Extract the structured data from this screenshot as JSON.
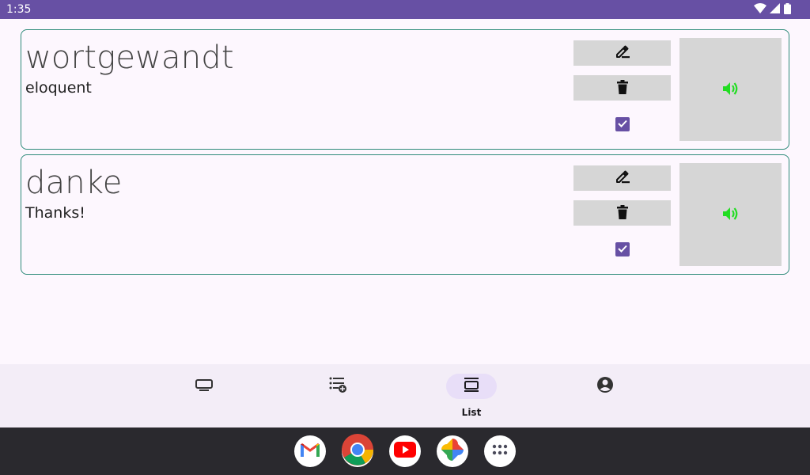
{
  "status_bar": {
    "time": "1:35",
    "background": "#6750a4"
  },
  "cards": [
    {
      "word": "wortgewandt",
      "translation": "eloquent",
      "checked": true,
      "edit_icon": "edit-icon",
      "delete_icon": "delete-icon",
      "speaker_icon": "speaker-icon"
    },
    {
      "word": "danke",
      "translation": "Thanks!",
      "checked": true,
      "edit_icon": "edit-icon",
      "delete_icon": "delete-icon",
      "speaker_icon": "speaker-icon"
    }
  ],
  "bottom_nav": {
    "items": [
      {
        "icon": "flashcard-icon",
        "label": ""
      },
      {
        "icon": "playlist-add-icon",
        "label": ""
      },
      {
        "icon": "list-icon",
        "label": "List",
        "active": true
      },
      {
        "icon": "account-icon",
        "label": ""
      }
    ]
  },
  "taskbar": {
    "apps": [
      "gmail-icon",
      "chrome-icon",
      "youtube-icon",
      "photos-icon",
      "app-drawer-icon"
    ]
  },
  "colors": {
    "accent": "#6750a4",
    "card_border": "#2e8b7a",
    "speaker_icon": "#22dd22",
    "button_bg": "#d6d6d6",
    "nav_bg": "#f3edf7",
    "active_indicator": "#e8def8",
    "taskbar_bg": "#2a292e"
  }
}
